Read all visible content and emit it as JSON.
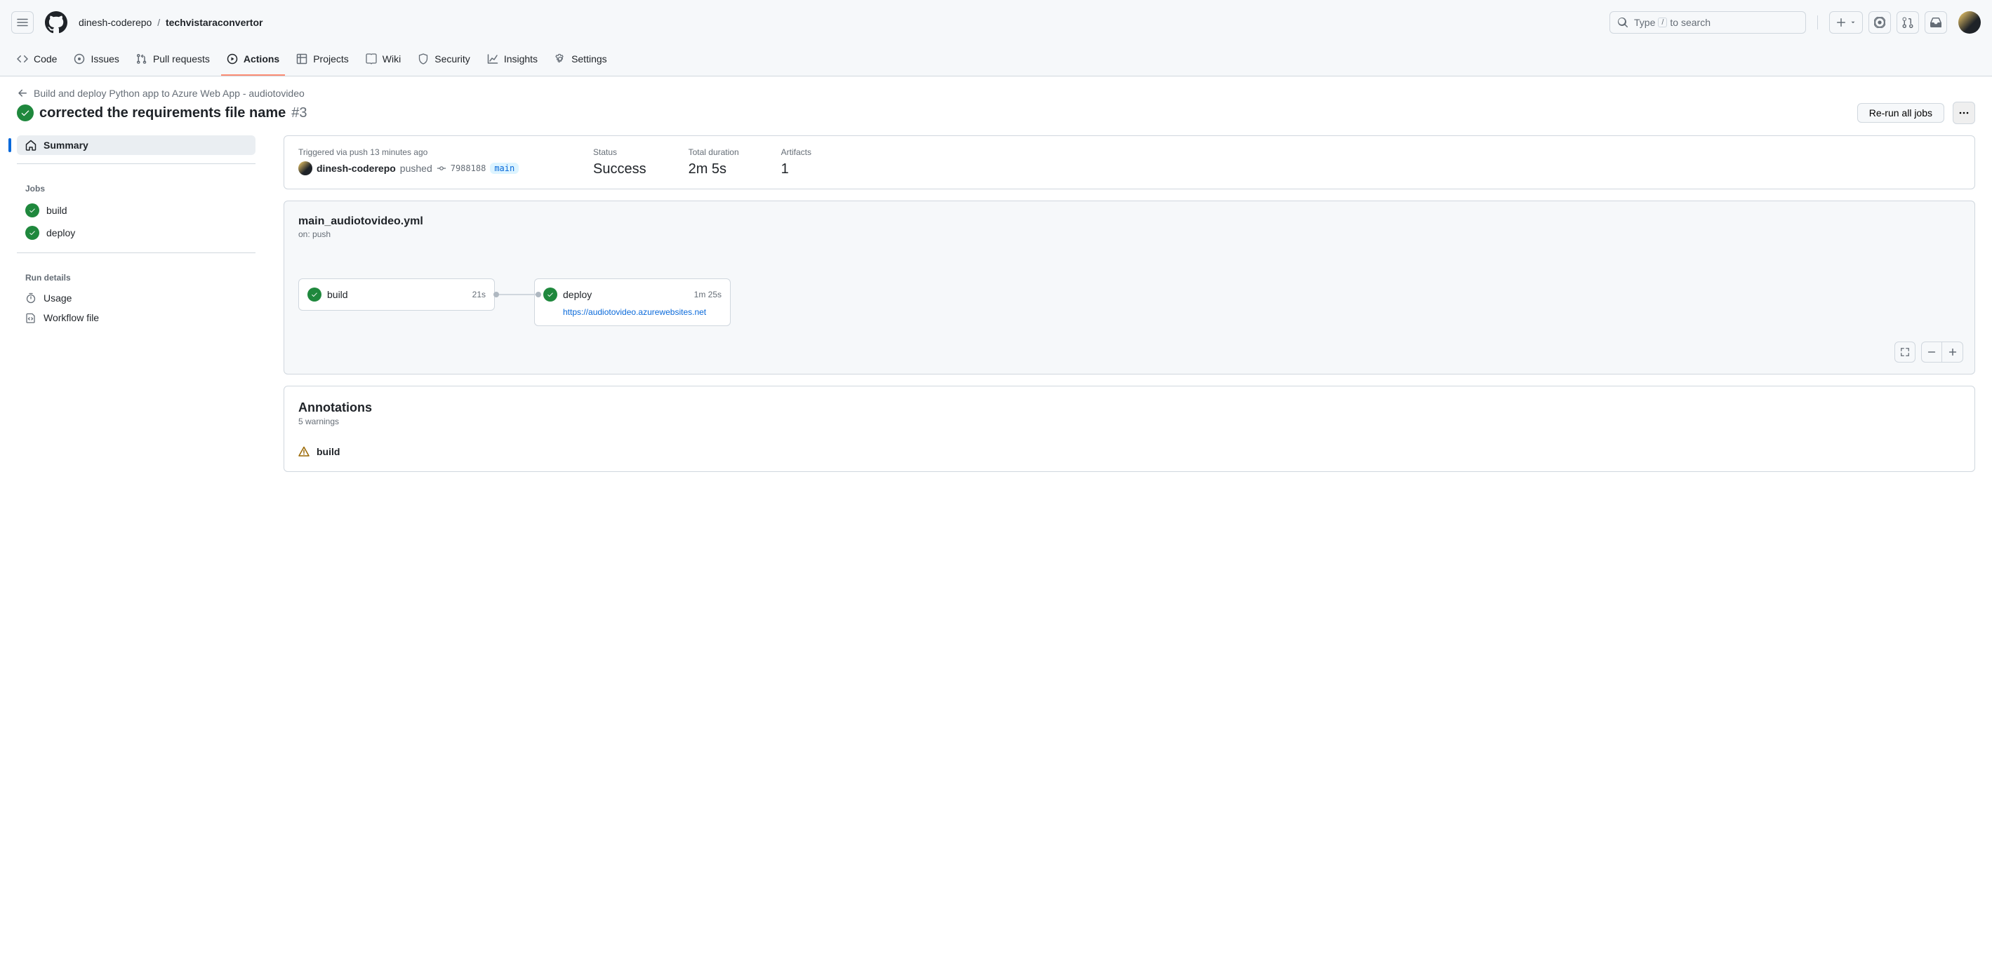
{
  "header": {
    "owner": "dinesh-coderepo",
    "sep": "/",
    "repo": "techvistaraconvertor",
    "search_prefix": "Type",
    "search_key": "/",
    "search_suffix": "to search"
  },
  "tabs": {
    "code": "Code",
    "issues": "Issues",
    "pulls": "Pull requests",
    "actions": "Actions",
    "projects": "Projects",
    "wiki": "Wiki",
    "security": "Security",
    "insights": "Insights",
    "settings": "Settings"
  },
  "workflow_back": "Build and deploy Python app to Azure Web App - audiotovideo",
  "run_title": "corrected the requirements file name",
  "run_number": "#3",
  "rerun_label": "Re-run all jobs",
  "sidebar": {
    "summary": "Summary",
    "jobs_heading": "Jobs",
    "jobs": {
      "build": "build",
      "deploy": "deploy"
    },
    "details_heading": "Run details",
    "usage": "Usage",
    "workflow_file": "Workflow file"
  },
  "meta": {
    "trigger_label": "Triggered via push 13 minutes ago",
    "actor": "dinesh-coderepo",
    "pushed": "pushed",
    "sha": "7988188",
    "branch": "main",
    "status_label": "Status",
    "status_value": "Success",
    "duration_label": "Total duration",
    "duration_value": "2m 5s",
    "artifacts_label": "Artifacts",
    "artifacts_value": "1"
  },
  "graph": {
    "filename": "main_audiotovideo.yml",
    "trigger": "on: push",
    "build": {
      "name": "build",
      "duration": "21s"
    },
    "deploy": {
      "name": "deploy",
      "duration": "1m 25s",
      "url": "https://audiotovideo.azurewebsites.net"
    }
  },
  "annotations": {
    "title": "Annotations",
    "sub": "5 warnings",
    "item1": "build"
  }
}
